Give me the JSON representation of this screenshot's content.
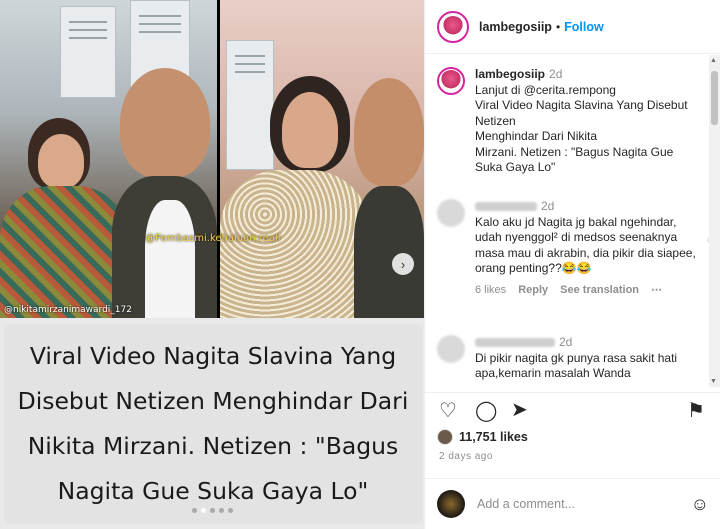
{
  "media": {
    "watermark_left": "@nikitamirzanimawardi_172",
    "watermark_right": "@Pembasmi.kehaluan.reall",
    "caption_lines": [
      "Viral Video Nagita Slavina Yang",
      "Disebut Netizen Menghindar Dari",
      "Nikita Mirzani. Netizen : \"Bagus",
      "Nagita Gue Suka Gaya Lo\""
    ],
    "slides_total": 5,
    "slide_active": 1
  },
  "header": {
    "username": "lambegosiip",
    "separator": "•",
    "follow_label": "Follow"
  },
  "post_caption": {
    "username": "lambegosiip",
    "time": "2d",
    "lines": [
      "Lanjut di @cerita.rempong",
      "Viral Video Nagita Slavina Yang Disebut Netizen",
      "Menghindar Dari Nikita",
      "Mirzani. Netizen : \"Bagus Nagita Gue",
      "Suka Gaya Lo\""
    ]
  },
  "comments": [
    {
      "time": "2d",
      "text": "Kalo aku jd Nagita jg bakal ngehindar, udah nyenggol² di medsos seenaknya masa mau di akrabin, dia pikir dia siapee, orang penting??😂😂",
      "likes": "6 likes",
      "reply": "Reply",
      "translate": "See translation"
    },
    {
      "time": "2d",
      "text": "Di pikir nagita gk punya rasa sakit hati apa,kemarin masalah Wanda"
    }
  ],
  "actions": {
    "likes": "11,751 likes",
    "date": "2 days ago"
  },
  "add_comment": {
    "placeholder": "Add a comment..."
  },
  "icons": {
    "heart": "heart-icon",
    "comment": "comment-icon",
    "share": "share-icon",
    "save": "bookmark-icon",
    "emoji": "emoji-icon",
    "next": "chevron-right-icon"
  }
}
